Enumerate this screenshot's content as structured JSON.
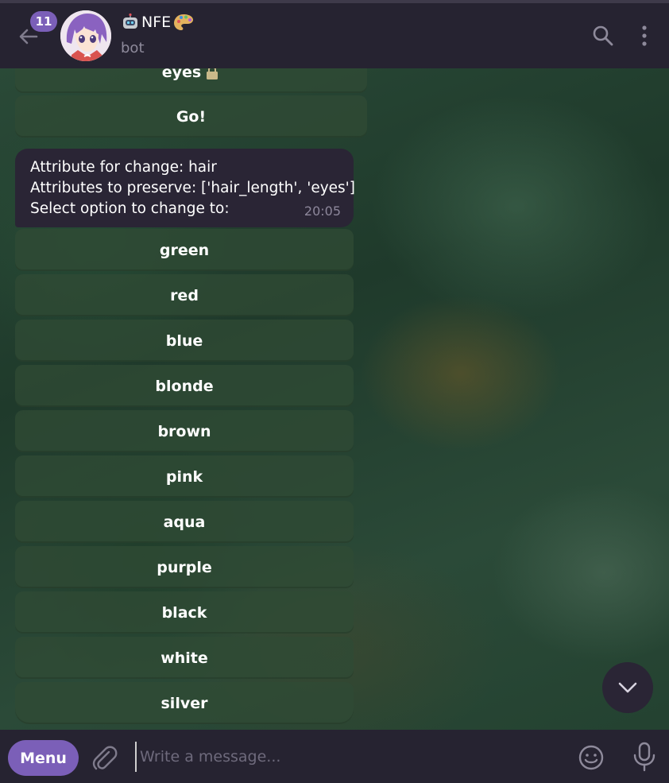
{
  "header": {
    "unread_count": "11",
    "title": "NFE",
    "subtitle": "bot"
  },
  "messages": {
    "prev_button_partial": "eyes",
    "go_button": "Go!",
    "bubble": {
      "line1": "Attribute for change: hair",
      "line2": "Attributes to preserve: ['hair_length', 'eyes']",
      "line3": "Select option to change to:",
      "time": "20:05"
    },
    "options": [
      "green",
      "red",
      "blue",
      "blonde",
      "brown",
      "pink",
      "aqua",
      "purple",
      "black",
      "white",
      "silver"
    ]
  },
  "composer": {
    "menu_label": "Menu",
    "placeholder": "Write a message..."
  },
  "colors": {
    "accent": "#7b5fb8",
    "header_bg": "#262331",
    "bubble_bg": "#2a2535",
    "keyboard_button_bg": "#304a34"
  }
}
